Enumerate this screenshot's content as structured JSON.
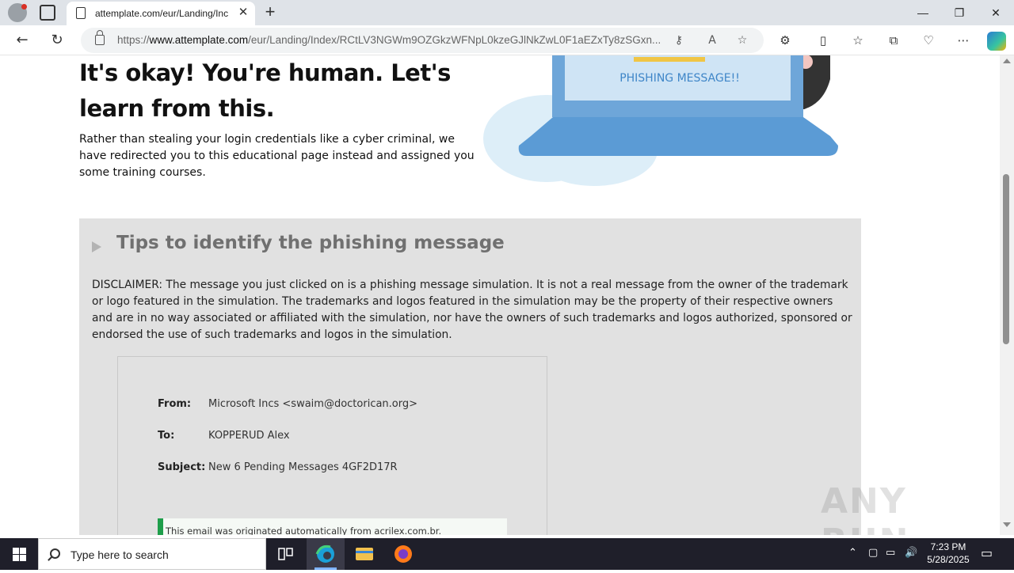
{
  "browser": {
    "tab_title": "attemplate.com/eur/Landing/Inc",
    "url_prefix": "https://",
    "url_domain": "www.attemplate.com",
    "url_path": "/eur/Landing/Index/RCtLV3NGWm9OZGkzWFNpL0kzeGJlNkZwL0F1aEZxTy8zSGxn..."
  },
  "hero": {
    "title": "It's okay! You're human. Let's learn from this.",
    "text": "Rather than stealing your login credentials like a cyber criminal, we have redirected you to this educational page instead and assigned you some training courses.",
    "illustration_caption": "PHISHING MESSAGE!!"
  },
  "tips": {
    "heading": "Tips to identify the phishing message",
    "disclaimer": "DISCLAIMER: The message you just clicked on is a phishing message simulation. It is not a real message from the owner of the trademark or logo featured in the simulation. The trademarks and logos featured in the simulation may be the property of their respective owners and are in no way associated or affiliated with the simulation, nor have the owners of such trademarks and logos authorized, sponsored or endorsed the use of such trademarks and logos in the simulation."
  },
  "email": {
    "from_label": "From:",
    "from_value": "Microsoft Incs <swaim@doctorican.org>",
    "to_label": "To:",
    "to_value": "KOPPERUD Alex",
    "subject_label": "Subject:",
    "subject_value": "New 6 Pending Messages 4GF2D17R",
    "notice": "This email was originated automatically from acrilex.com.br."
  },
  "watermark": "ANY RUN",
  "taskbar": {
    "search_placeholder": "Type here to search",
    "time": "7:23 PM",
    "date": "5/28/2025"
  },
  "colors": {
    "tips_background": "#e1e1e1",
    "notice_bar": "#1e9e4a",
    "laptop_blue": "#5b9bd5",
    "taskbar": "#1f1f2a"
  }
}
